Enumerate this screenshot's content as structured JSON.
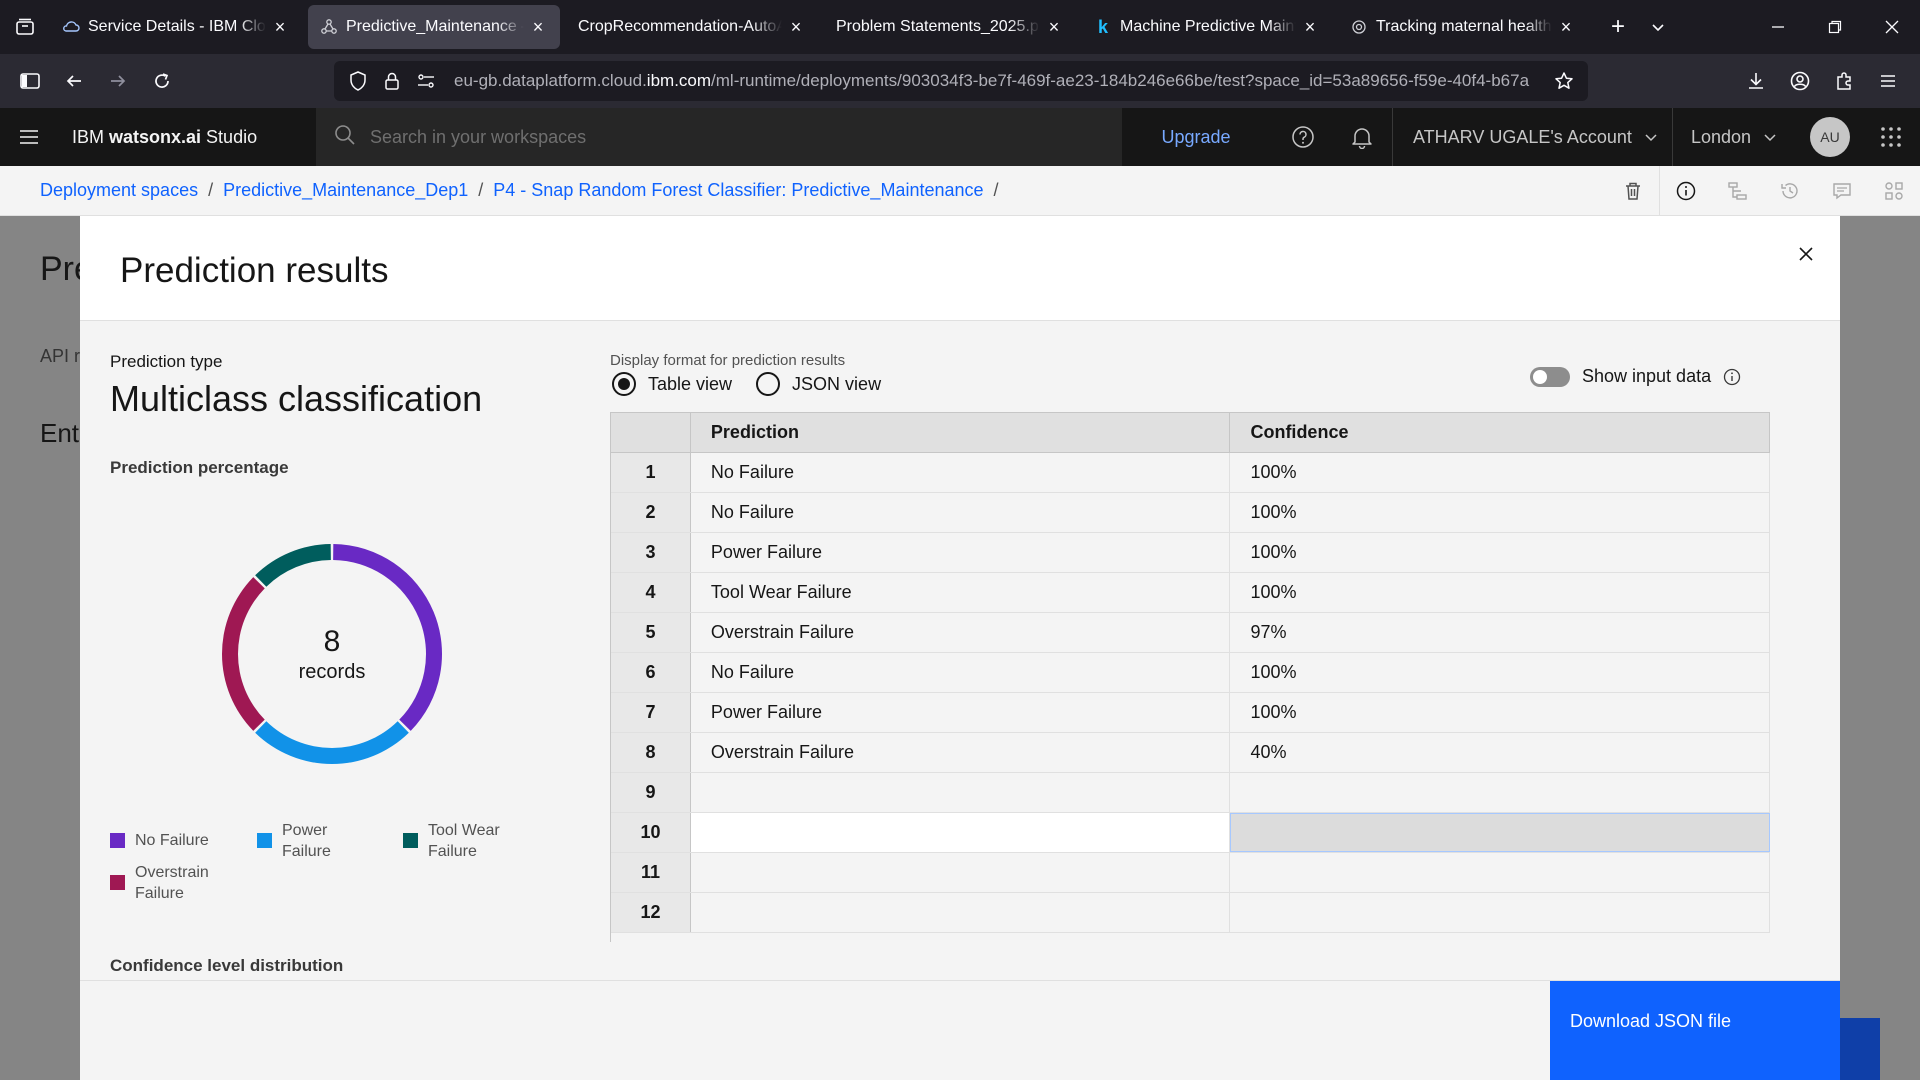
{
  "browser": {
    "tabs": [
      {
        "title": "Service Details - IBM Cloud",
        "icon": "cloud-icon",
        "active": false
      },
      {
        "title": "Predictive_Maintenance — I",
        "icon": "deployment-icon",
        "active": true
      },
      {
        "title": "CropRecommendation-AutoAI.p",
        "icon": "",
        "active": false
      },
      {
        "title": "Problem Statements_2025.p",
        "icon": "",
        "active": false
      },
      {
        "title": "Machine Predictive Mainten",
        "icon": "kaggle-icon",
        "active": false
      },
      {
        "title": "Tracking maternal health pro",
        "icon": "chatgpt-icon",
        "active": false
      }
    ],
    "url_prefix": "eu-gb.dataplatform.cloud.",
    "url_domain": "ibm.com",
    "url_rest": "/ml-runtime/deployments/903034f3-be7f-469f-ae23-184b246e66be/test?space_id=53a89656-f59e-40f4-b67a"
  },
  "header": {
    "product_prefix": "IBM ",
    "product_name": "watsonx.ai",
    "product_suffix": " Studio",
    "search_placeholder": "Search in your workspaces",
    "upgrade": "Upgrade",
    "account": "ATHARV UGALE's Account",
    "region": "London",
    "avatar": "AU"
  },
  "breadcrumb": [
    "Deployment spaces",
    "Predictive_Maintenance_Dep1",
    "P4 - Snap Random Forest Classifier: Predictive_Maintenance"
  ],
  "background": {
    "title": "Pre",
    "tab": "API r",
    "section": "Ente"
  },
  "modal": {
    "title": "Prediction results",
    "prediction_type_label": "Prediction type",
    "prediction_type": "Multiclass classification",
    "prediction_percentage_label": "Prediction percentage",
    "donut": {
      "count": "8",
      "unit": "records",
      "segments": [
        {
          "label": "No Failure",
          "value": 3,
          "color": "#6929c4"
        },
        {
          "label": "Power Failure",
          "value": 2,
          "color": "#1192e8"
        },
        {
          "label": "Overstrain Failure",
          "value": 2,
          "color": "#9f1853"
        },
        {
          "label": "Tool Wear Failure",
          "value": 1,
          "color": "#005d5d"
        }
      ]
    },
    "legend": [
      {
        "label": "No Failure",
        "color": "#6929c4"
      },
      {
        "label": "Power Failure",
        "color": "#1192e8"
      },
      {
        "label": "Tool Wear Failure",
        "color": "#005d5d"
      },
      {
        "label": "Overstrain Failure",
        "color": "#9f1853"
      }
    ],
    "confidence_label": "Confidence level distribution",
    "display_format_label": "Display format for prediction results",
    "table_view": "Table view",
    "json_view": "JSON view",
    "show_input": "Show input data",
    "columns": [
      "Prediction",
      "Confidence"
    ],
    "rows": [
      {
        "n": "1",
        "prediction": "No Failure",
        "confidence": "100%"
      },
      {
        "n": "2",
        "prediction": "No Failure",
        "confidence": "100%"
      },
      {
        "n": "3",
        "prediction": "Power Failure",
        "confidence": "100%"
      },
      {
        "n": "4",
        "prediction": "Tool Wear Failure",
        "confidence": "100%"
      },
      {
        "n": "5",
        "prediction": "Overstrain Failure",
        "confidence": "97%"
      },
      {
        "n": "6",
        "prediction": "No Failure",
        "confidence": "100%"
      },
      {
        "n": "7",
        "prediction": "Power Failure",
        "confidence": "100%"
      },
      {
        "n": "8",
        "prediction": "Overstrain Failure",
        "confidence": "40%"
      },
      {
        "n": "9",
        "prediction": "",
        "confidence": ""
      },
      {
        "n": "10",
        "prediction": "",
        "confidence": ""
      },
      {
        "n": "11",
        "prediction": "",
        "confidence": ""
      },
      {
        "n": "12",
        "prediction": "",
        "confidence": ""
      }
    ],
    "download_button": "Download JSON file"
  }
}
